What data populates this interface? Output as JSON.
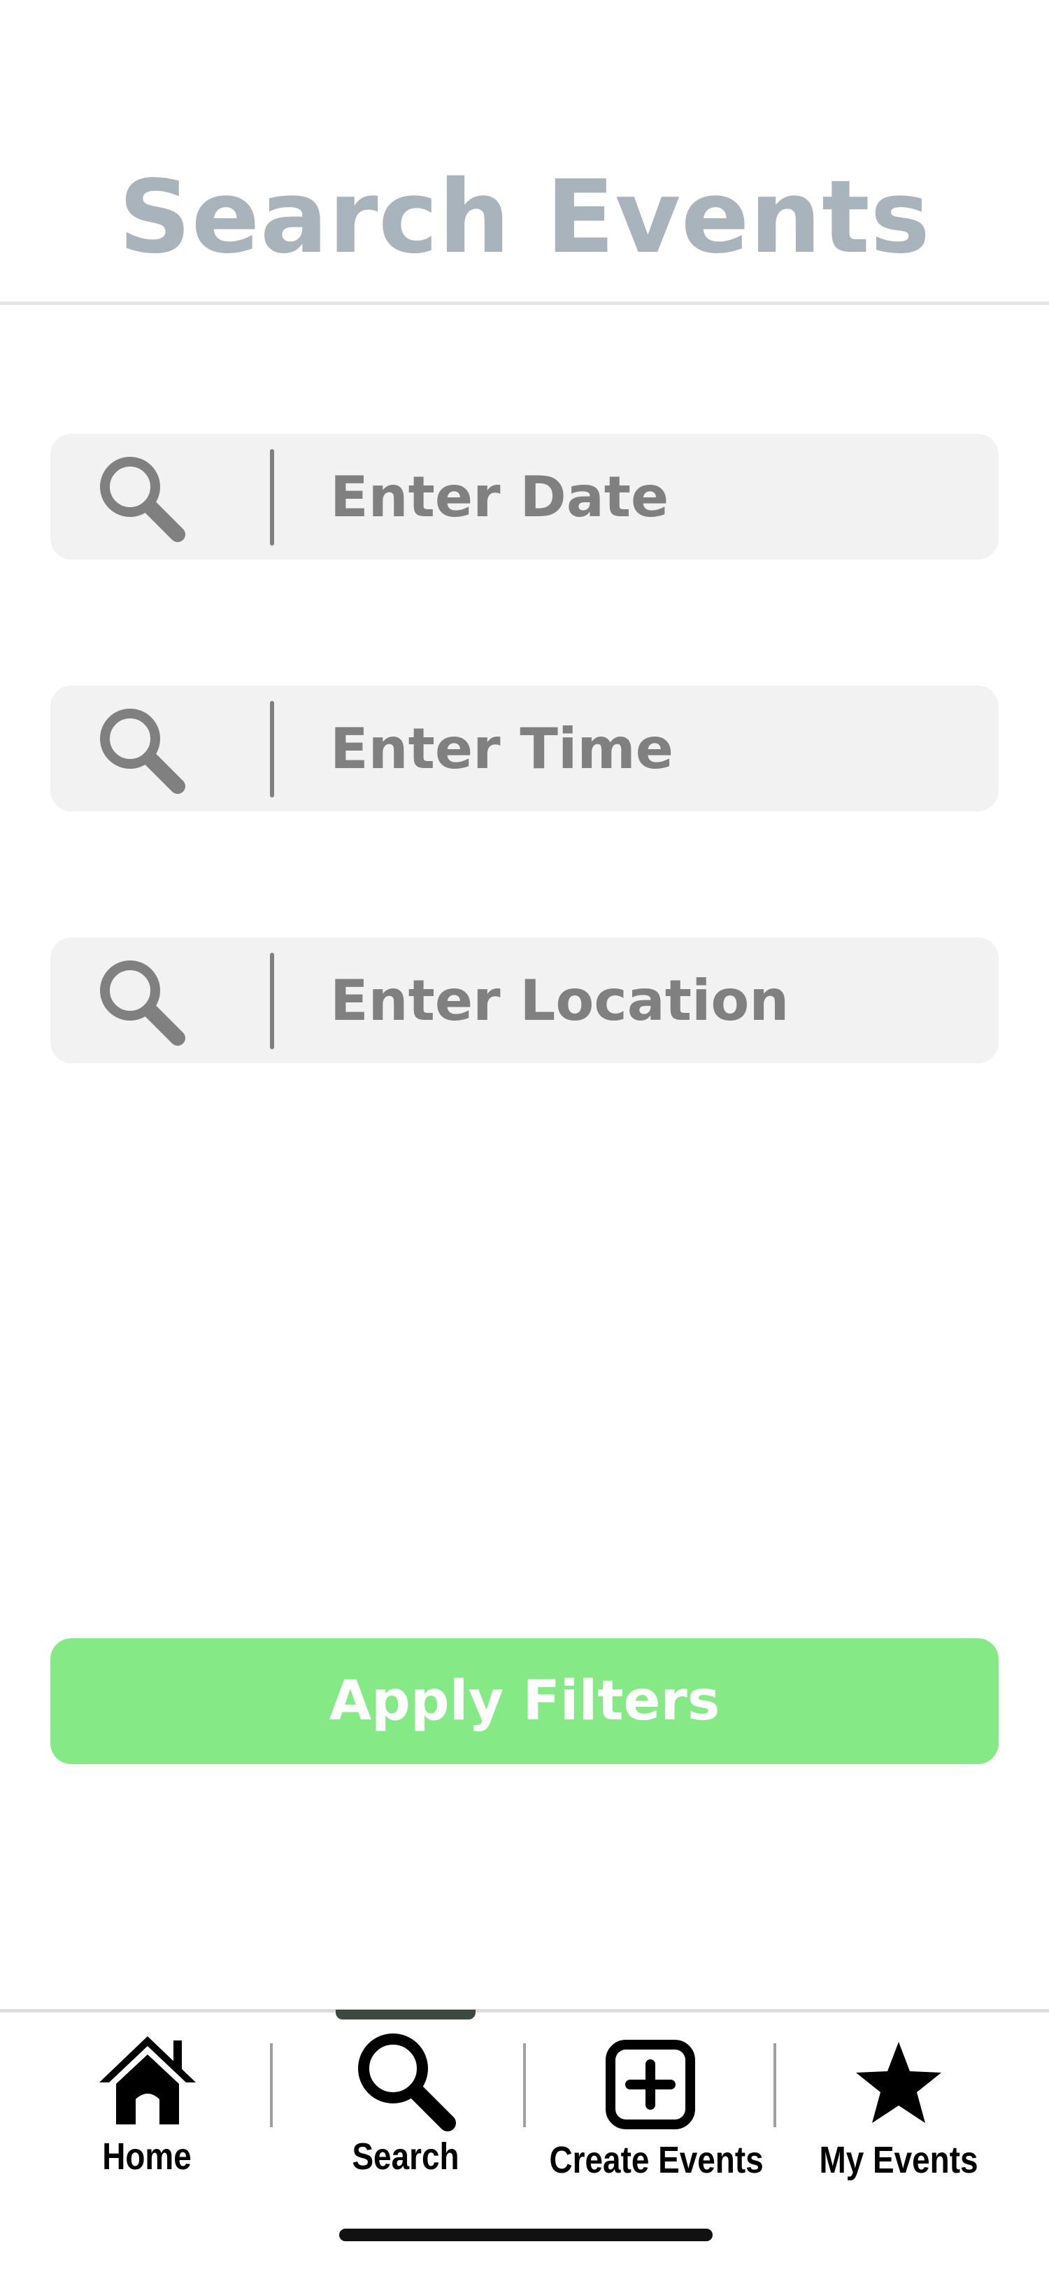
{
  "header": {
    "title": "Search Events"
  },
  "filters": {
    "date": {
      "placeholder": "Enter Date",
      "value": "",
      "icon": "search-icon"
    },
    "time": {
      "placeholder": "Enter Time",
      "value": "",
      "icon": "search-icon"
    },
    "location": {
      "placeholder": "Enter Location",
      "value": "",
      "icon": "search-icon"
    }
  },
  "apply_button": {
    "label": "Apply Filters"
  },
  "tabbar": {
    "active": "Search",
    "tabs": [
      {
        "label": "Home",
        "icon": "home-icon"
      },
      {
        "label": "Search",
        "icon": "search-icon"
      },
      {
        "label": "Create Events",
        "icon": "plus-square-icon"
      },
      {
        "label": "My Events",
        "icon": "star-icon"
      }
    ]
  },
  "colors": {
    "title": "#a9b3bb",
    "field_bg": "#f2f2f2",
    "placeholder": "#808080",
    "apply_button": "#85ea85",
    "active_indicator": "#3a4a40"
  }
}
